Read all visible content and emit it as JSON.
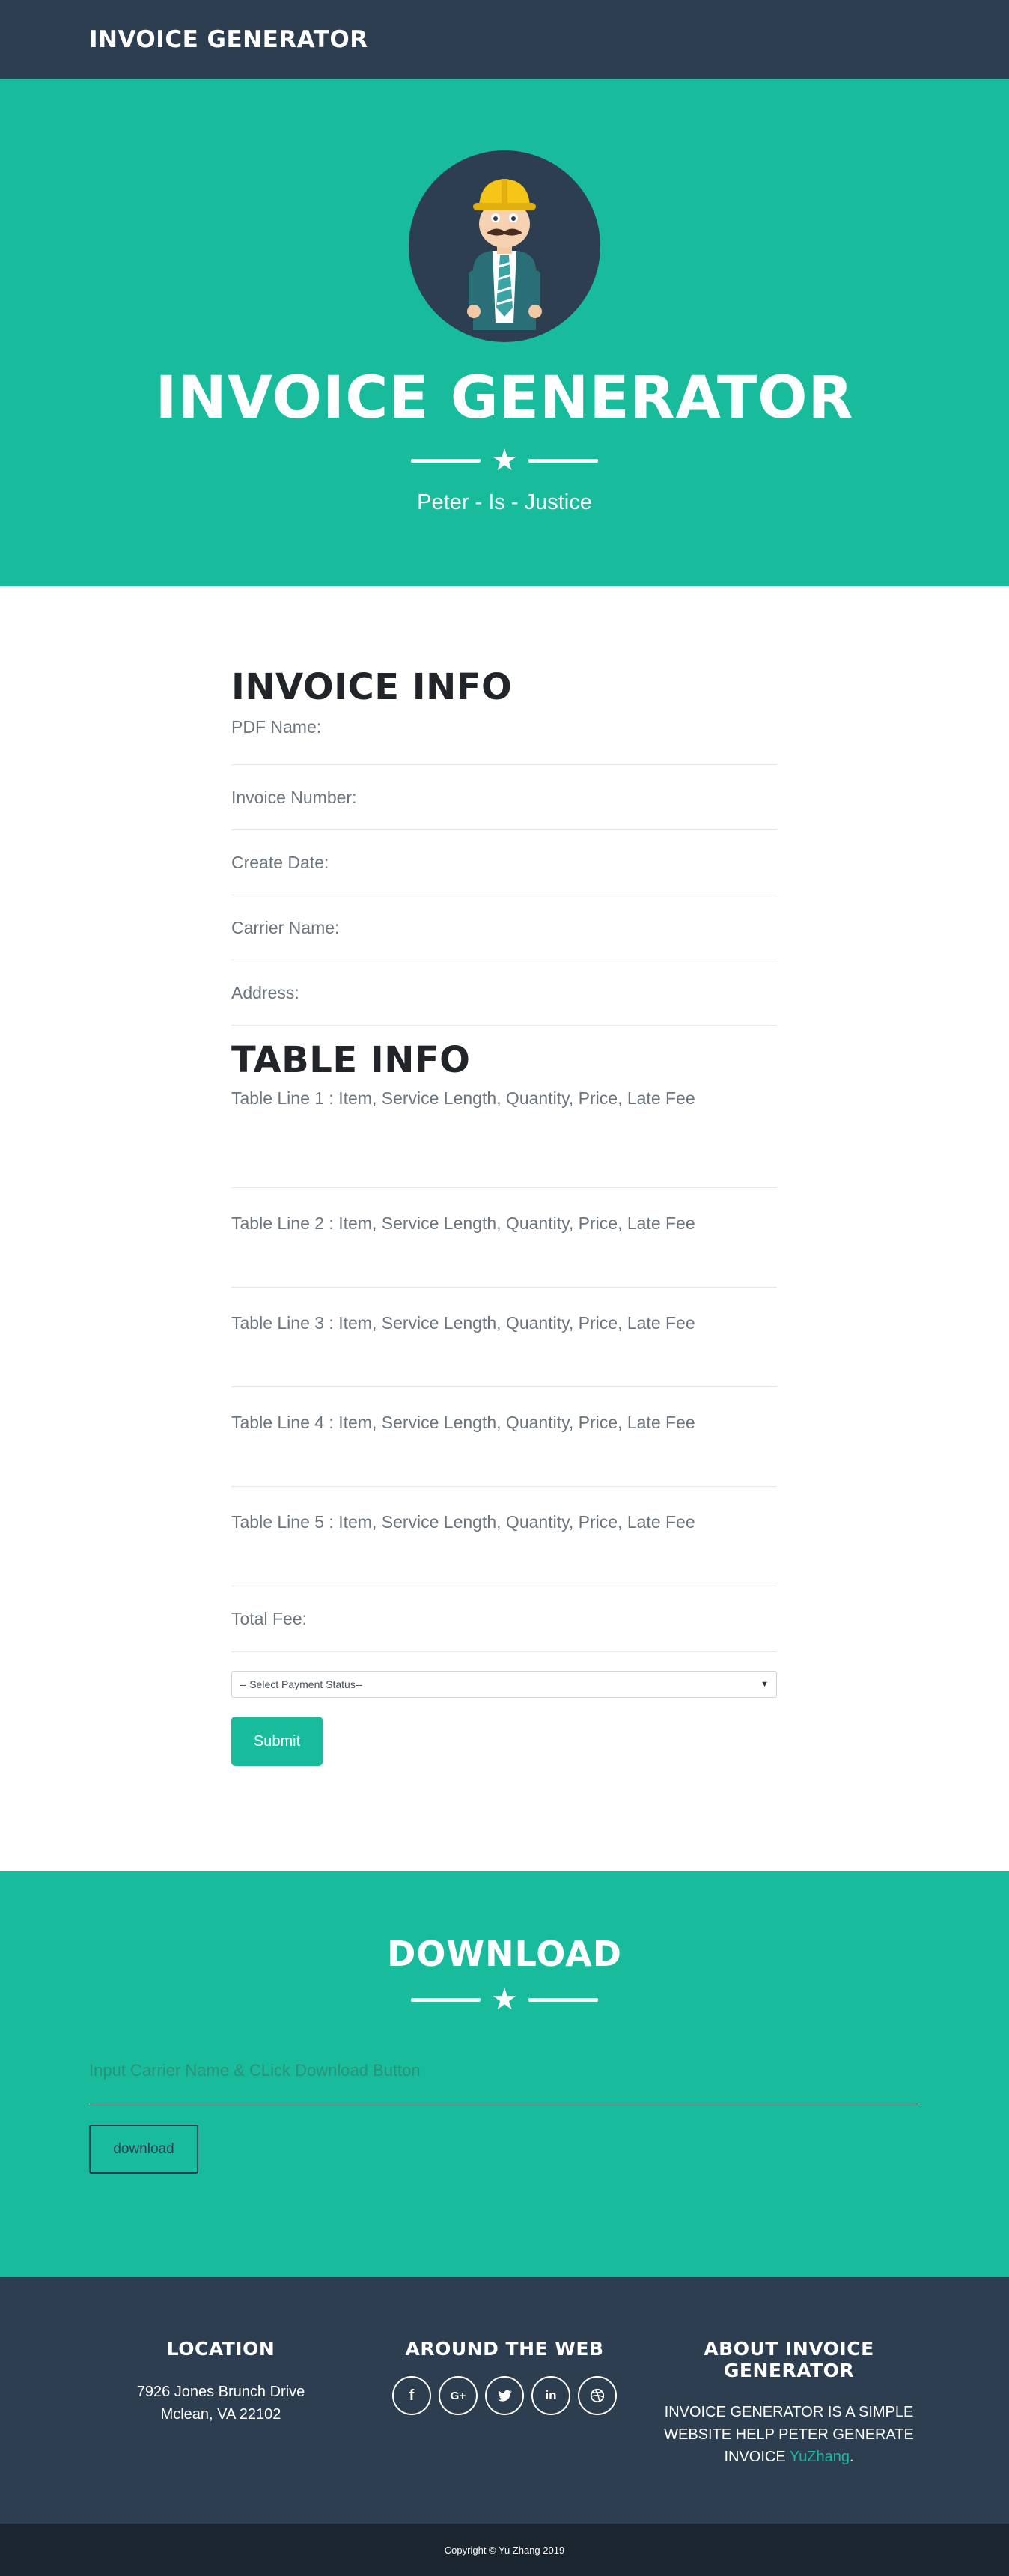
{
  "navbar": {
    "brand": "INVOICE GENERATOR"
  },
  "hero": {
    "title": "INVOICE GENERATOR",
    "subtitle": "Peter - Is - Justice"
  },
  "invoice_info": {
    "heading": "INVOICE INFO",
    "fields": [
      {
        "placeholder": "PDF Name:"
      },
      {
        "placeholder": "Invoice Number:"
      },
      {
        "placeholder": "Create Date:"
      },
      {
        "placeholder": "Carrier Name:"
      },
      {
        "placeholder": "Address:"
      }
    ]
  },
  "table_info": {
    "heading": "TABLE INFO",
    "lines": [
      {
        "placeholder": "Table Line 1 : Item, Service Length, Quantity, Price, Late Fee"
      },
      {
        "placeholder": "Table Line 2 : Item, Service Length, Quantity, Price, Late Fee"
      },
      {
        "placeholder": "Table Line 3 :  Item, Service Length, Quantity, Price, Late Fee"
      },
      {
        "placeholder": "Table Line 4 :  Item, Service Length, Quantity, Price, Late Fee"
      },
      {
        "placeholder": "Table Line 5 :  Item, Service Length, Quantity, Price, Late Fee"
      }
    ],
    "total_placeholder": "Total Fee:",
    "payment_select": "-- Select Payment Status--",
    "submit_label": "Submit"
  },
  "download": {
    "title": "DOWNLOAD",
    "input_placeholder": "Input Carrier Name & CLick Download Button",
    "button_label": "download"
  },
  "footer": {
    "location_heading": "LOCATION",
    "address_line1": "7926 Jones Brunch Drive",
    "address_line2": "Mclean, VA 22102",
    "web_heading": "AROUND THE WEB",
    "socials": [
      "facebook-icon",
      "google-plus-icon",
      "twitter-icon",
      "linkedin-icon",
      "dribbble-icon"
    ],
    "about_heading": "ABOUT INVOICE GENERATOR",
    "about_text": "INVOICE GENERATOR IS A SIMPLE WEBSITE HELP PETER GENERATE INVOICE",
    "about_link": "YuZhang",
    "about_end": "."
  },
  "copyright": "Copyright © Yu Zhang 2019",
  "colors": {
    "primary": "#2c3e50",
    "accent": "#18bc9c",
    "footer_bottom": "#1a252f"
  }
}
